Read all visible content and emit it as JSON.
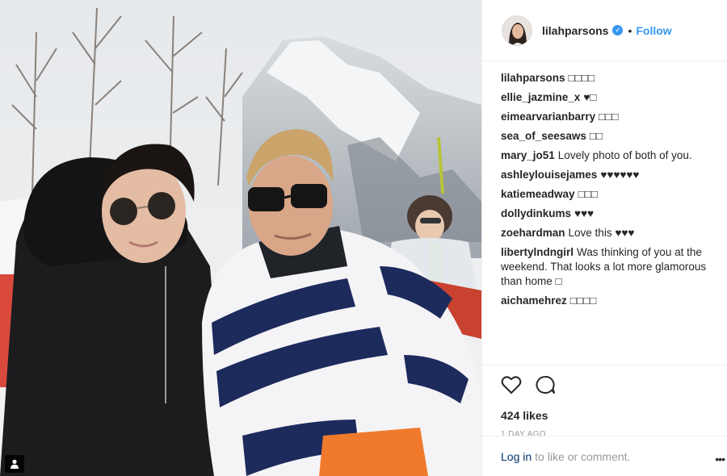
{
  "post": {
    "username": "lilahparsons",
    "follow_label": "Follow",
    "separator": "•",
    "verified_icon": "verified-badge-icon"
  },
  "comments": [
    {
      "author": "lilahparsons",
      "text": "□□□□"
    },
    {
      "author": "ellie_jazmine_x",
      "text": "♥□"
    },
    {
      "author": "eimearvarianbarry",
      "text": "□□□"
    },
    {
      "author": "sea_of_seesaws",
      "text": "□□"
    },
    {
      "author": "mary_jo51",
      "text": "Lovely photo of both of you."
    },
    {
      "author": "ashleylouisejames",
      "text": "♥♥♥♥♥♥"
    },
    {
      "author": "katiemeadway",
      "text": "□□□"
    },
    {
      "author": "dollydinkums",
      "text": "♥♥♥"
    },
    {
      "author": "zoehardman",
      "text": "Love this ♥♥♥"
    },
    {
      "author": "libertylndngirl",
      "text": "Was thinking of you at the weekend. That looks a lot more glamorous than home □"
    },
    {
      "author": "aichamehrez",
      "text": "□□□□"
    }
  ],
  "actions": {
    "like_icon": "heart-icon",
    "comment_icon": "comment-icon",
    "likes": "424 likes",
    "timestamp": "1 DAY AGO"
  },
  "footer": {
    "login_label": "Log in",
    "suffix": "to like or comment.",
    "more_label": "•••"
  },
  "colors": {
    "link_blue": "#3897f0",
    "text": "#262626",
    "muted": "#999999",
    "border": "#efefef"
  }
}
